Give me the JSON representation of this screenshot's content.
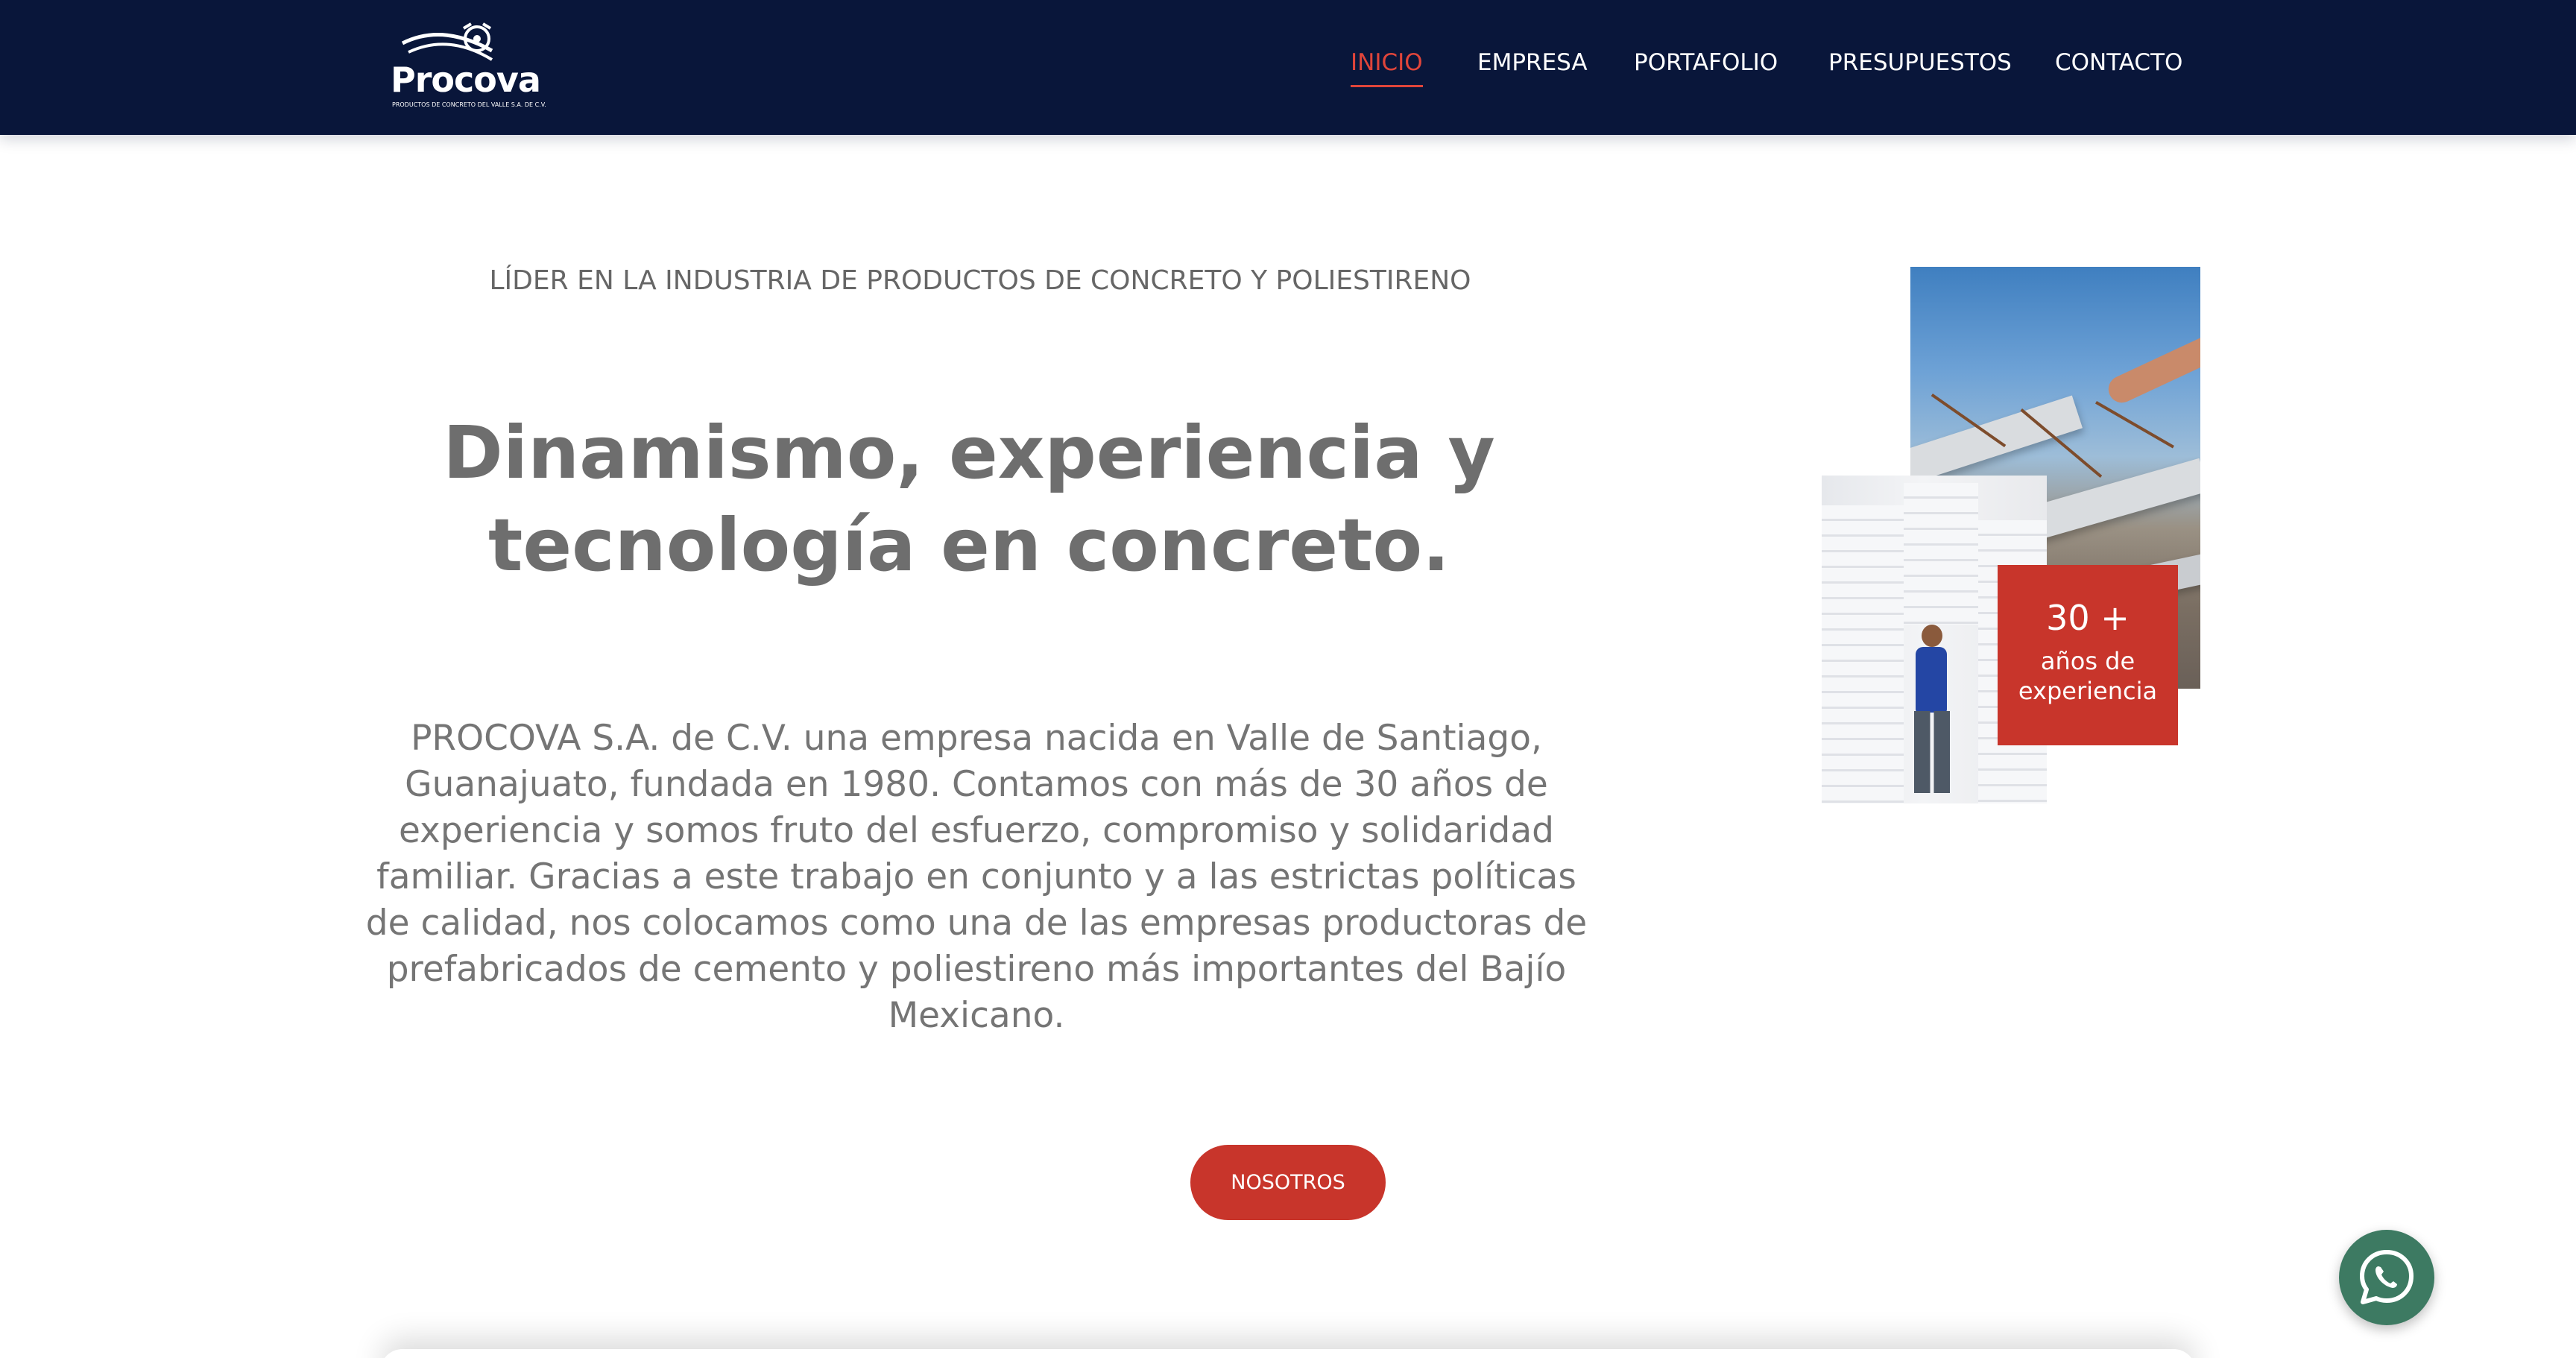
{
  "brand": {
    "name": "Procova",
    "tagline": "PRODUCTOS DE CONCRETO DEL VALLE S.A. DE C.V.",
    "icon": "procova-logo"
  },
  "nav": {
    "items": [
      {
        "label": "INICIO",
        "active": true
      },
      {
        "label": "EMPRESA",
        "active": false
      },
      {
        "label": "PORTAFOLIO",
        "active": false
      },
      {
        "label": "PRESUPUESTOS",
        "active": false
      },
      {
        "label": "CONTACTO",
        "active": false
      }
    ]
  },
  "hero": {
    "eyebrow": "LÍDER EN LA INDUSTRIA DE PRODUCTOS DE CONCRETO Y POLIESTIRENO",
    "headline": "Dinamismo, experiencia y tecnología en concreto.",
    "body": "PROCOVA S.A. de C.V. una empresa nacida en Valle de Santiago, Guanajuato, fundada en 1980. Contamos con más de 30 años de experiencia y somos fruto del esfuerzo, compromiso y solidaridad familiar. Gracias a este trabajo en conjunto y a las estrictas políticas de calidad, nos colocamos como una de las empresas productoras de prefabricados de cemento y poliestireno más importantes del Bajío Mexicano.",
    "cta_label": "NOSOTROS"
  },
  "badge": {
    "number": "30 +",
    "line1": "años de",
    "line2": "experiencia"
  },
  "colors": {
    "header_bg": "#09163a",
    "accent": "#c8352b",
    "nav_active": "#e0453a",
    "whatsapp": "#3d7a62"
  },
  "floating": {
    "icon": "whatsapp-icon"
  }
}
